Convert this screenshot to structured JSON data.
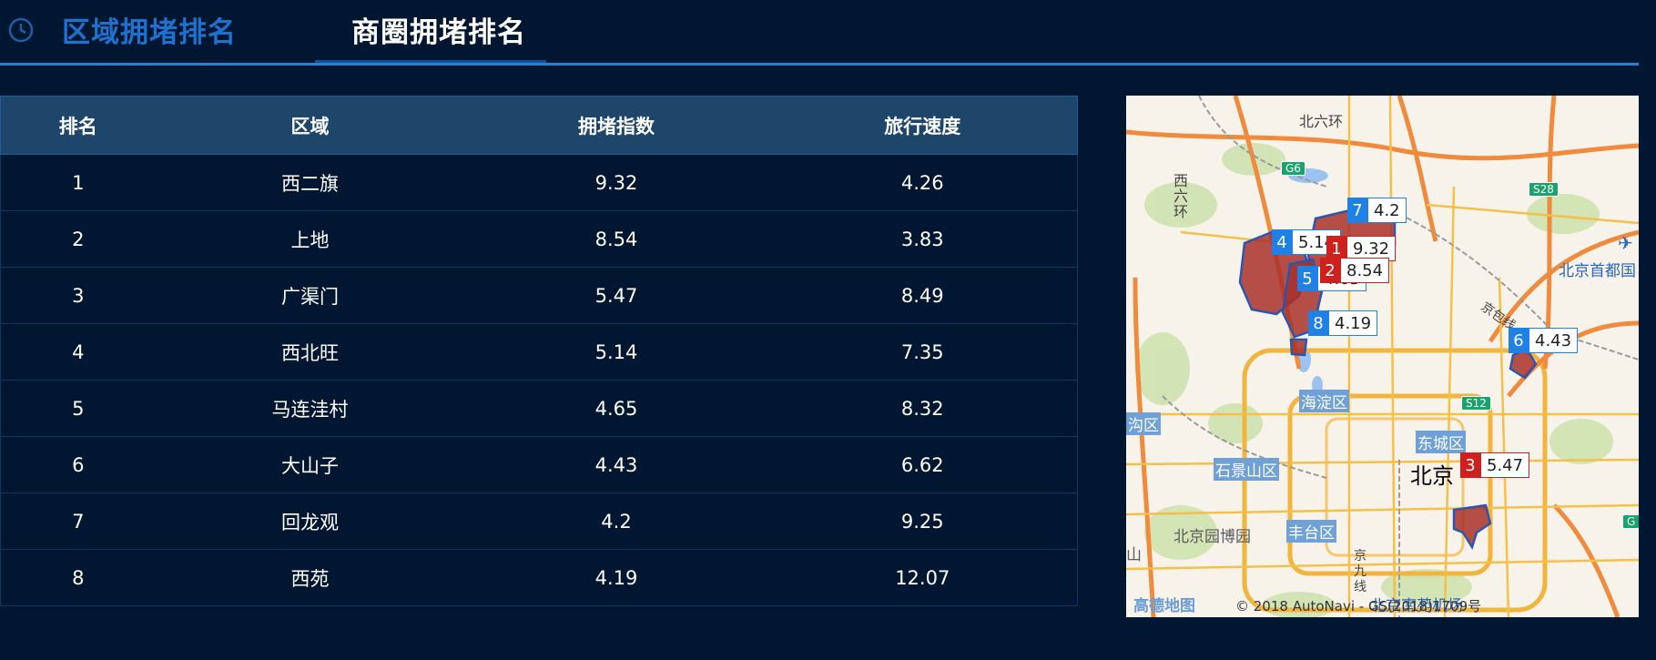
{
  "tabs": [
    {
      "label": "区域拥堵排名",
      "active": false
    },
    {
      "label": "商圈拥堵排名",
      "active": true
    }
  ],
  "table": {
    "headers": [
      "排名",
      "区域",
      "拥堵指数",
      "旅行速度"
    ],
    "rows": [
      [
        "1",
        "西二旗",
        "9.32",
        "4.26"
      ],
      [
        "2",
        "上地",
        "8.54",
        "3.83"
      ],
      [
        "3",
        "广渠门",
        "5.47",
        "8.49"
      ],
      [
        "4",
        "西北旺",
        "5.14",
        "7.35"
      ],
      [
        "5",
        "马连洼村",
        "4.65",
        "8.32"
      ],
      [
        "6",
        "大山子",
        "4.43",
        "6.62"
      ],
      [
        "7",
        "回龙观",
        "4.2",
        "9.25"
      ],
      [
        "8",
        "西苑",
        "4.19",
        "12.07"
      ]
    ]
  },
  "map": {
    "labels": {
      "north_sixth_ring": "北六环",
      "west_sixth_ring": "西六环",
      "haidian": "海淀区",
      "dongcheng": "东城区",
      "shijingshan": "石景山区",
      "fengtai": "丰台区",
      "beijing": "北京",
      "airport": "北京首都国",
      "garden_expo": "北京园博园",
      "south_airport": "北京南苑机场",
      "mentougou": "沟区",
      "shan": "山",
      "jingbao": "京包线",
      "jingjiu": "京九线"
    },
    "shields": [
      "G6",
      "S28",
      "S12",
      "G"
    ],
    "markers": [
      {
        "rank": "1",
        "value": "9.32",
        "color": "red"
      },
      {
        "rank": "2",
        "value": "8.54",
        "color": "red"
      },
      {
        "rank": "3",
        "value": "5.47",
        "color": "red"
      },
      {
        "rank": "4",
        "value": "5.14",
        "color": "blue"
      },
      {
        "rank": "5",
        "value": "4.65",
        "color": "blue"
      },
      {
        "rank": "6",
        "value": "4.43",
        "color": "blue"
      },
      {
        "rank": "7",
        "value": "4.2",
        "color": "blue"
      },
      {
        "rank": "8",
        "value": "4.19",
        "color": "blue"
      }
    ],
    "logo": "高德地图",
    "copyright": "© 2018 AutoNavi - GS(2018)1709号"
  },
  "colors": {
    "background": "#011630",
    "accent": "#2f7fd1",
    "header_row": "#1e466b",
    "marker_red": "#d0201e",
    "marker_blue": "#1f80e6",
    "area_fill": "#a8302a"
  }
}
